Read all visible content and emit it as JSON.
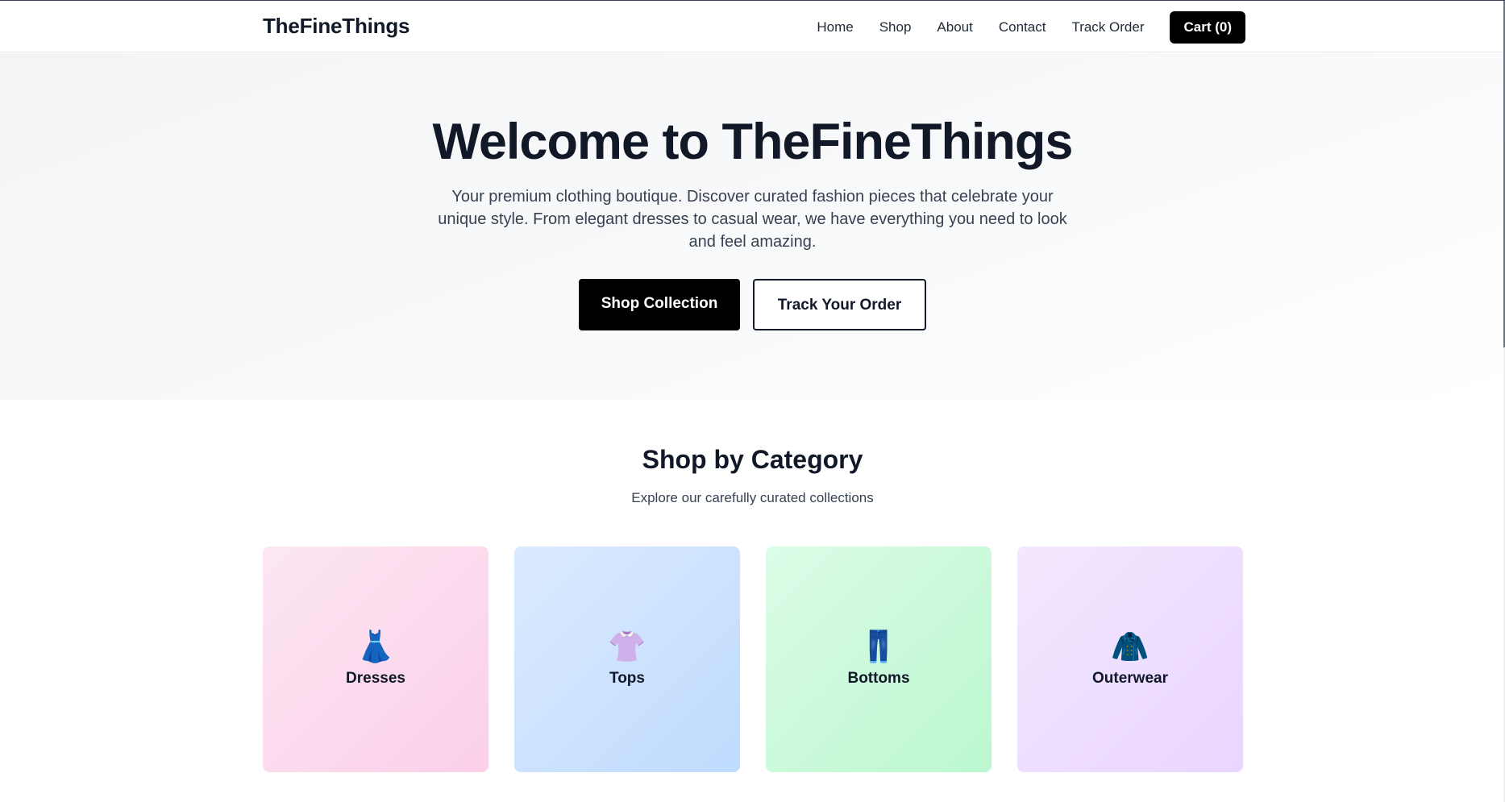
{
  "header": {
    "brand": "TheFineThings",
    "nav": [
      "Home",
      "Shop",
      "About",
      "Contact",
      "Track Order"
    ],
    "cart_label": "Cart (0)"
  },
  "hero": {
    "title": "Welcome to TheFineThings",
    "subtitle": "Your premium clothing boutique. Discover curated fashion pieces that celebrate your unique style. From elegant dresses to casual wear, we have everything you need to look and feel amazing.",
    "primary_button": "Shop Collection",
    "secondary_button": "Track Your Order"
  },
  "categories": {
    "title": "Shop by Category",
    "subtitle": "Explore our carefully curated collections",
    "items": [
      {
        "label": "Dresses",
        "icon": "👗",
        "icon_name": "dress-icon",
        "gradient": [
          "#fce7f3",
          "#fbcfe8"
        ]
      },
      {
        "label": "Tops",
        "icon": "👚",
        "icon_name": "shirt-icon",
        "gradient": [
          "#dbeafe",
          "#bfdbfe"
        ]
      },
      {
        "label": "Bottoms",
        "icon": "👖",
        "icon_name": "jeans-icon",
        "gradient": [
          "#dcfce7",
          "#bbf7d0"
        ]
      },
      {
        "label": "Outerwear",
        "icon": "🧥",
        "icon_name": "coat-icon",
        "gradient": [
          "#f3e8ff",
          "#e9d5ff"
        ]
      }
    ]
  },
  "colors": {
    "primary": "#000000",
    "text": "#111827",
    "muted": "#374151"
  }
}
